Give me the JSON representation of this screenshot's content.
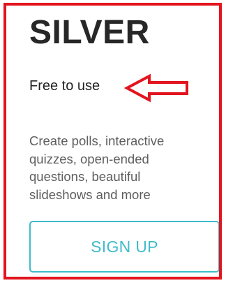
{
  "plan": {
    "title": "SILVER",
    "price_label": "Free to use",
    "description": "Create polls, interactive quizzes, open-ended questions, beautiful slideshows and more",
    "signup_label": "SIGN UP"
  },
  "annotation": {
    "highlight_color": "#e3141e",
    "arrow_icon": "left-arrow-icon"
  },
  "theme": {
    "accent": "#3fbcc9",
    "title_color": "#272727",
    "text_color": "#5e5e5e"
  }
}
